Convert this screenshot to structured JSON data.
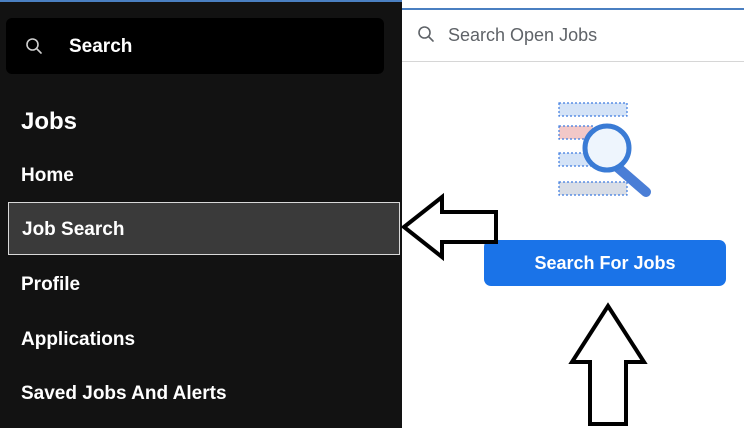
{
  "sidebar": {
    "search_label": "Search",
    "section_title": "Jobs",
    "items": [
      {
        "label": "Home"
      },
      {
        "label": "Job Search",
        "active": true
      },
      {
        "label": "Profile"
      },
      {
        "label": "Applications"
      },
      {
        "label": "Saved Jobs And Alerts"
      }
    ]
  },
  "main": {
    "search_placeholder": "Search Open Jobs",
    "button_label": "Search For Jobs"
  },
  "colors": {
    "sidebar_bg": "#121212",
    "active_item_bg": "#3a3a3a",
    "accent_button": "#1a73e8"
  }
}
